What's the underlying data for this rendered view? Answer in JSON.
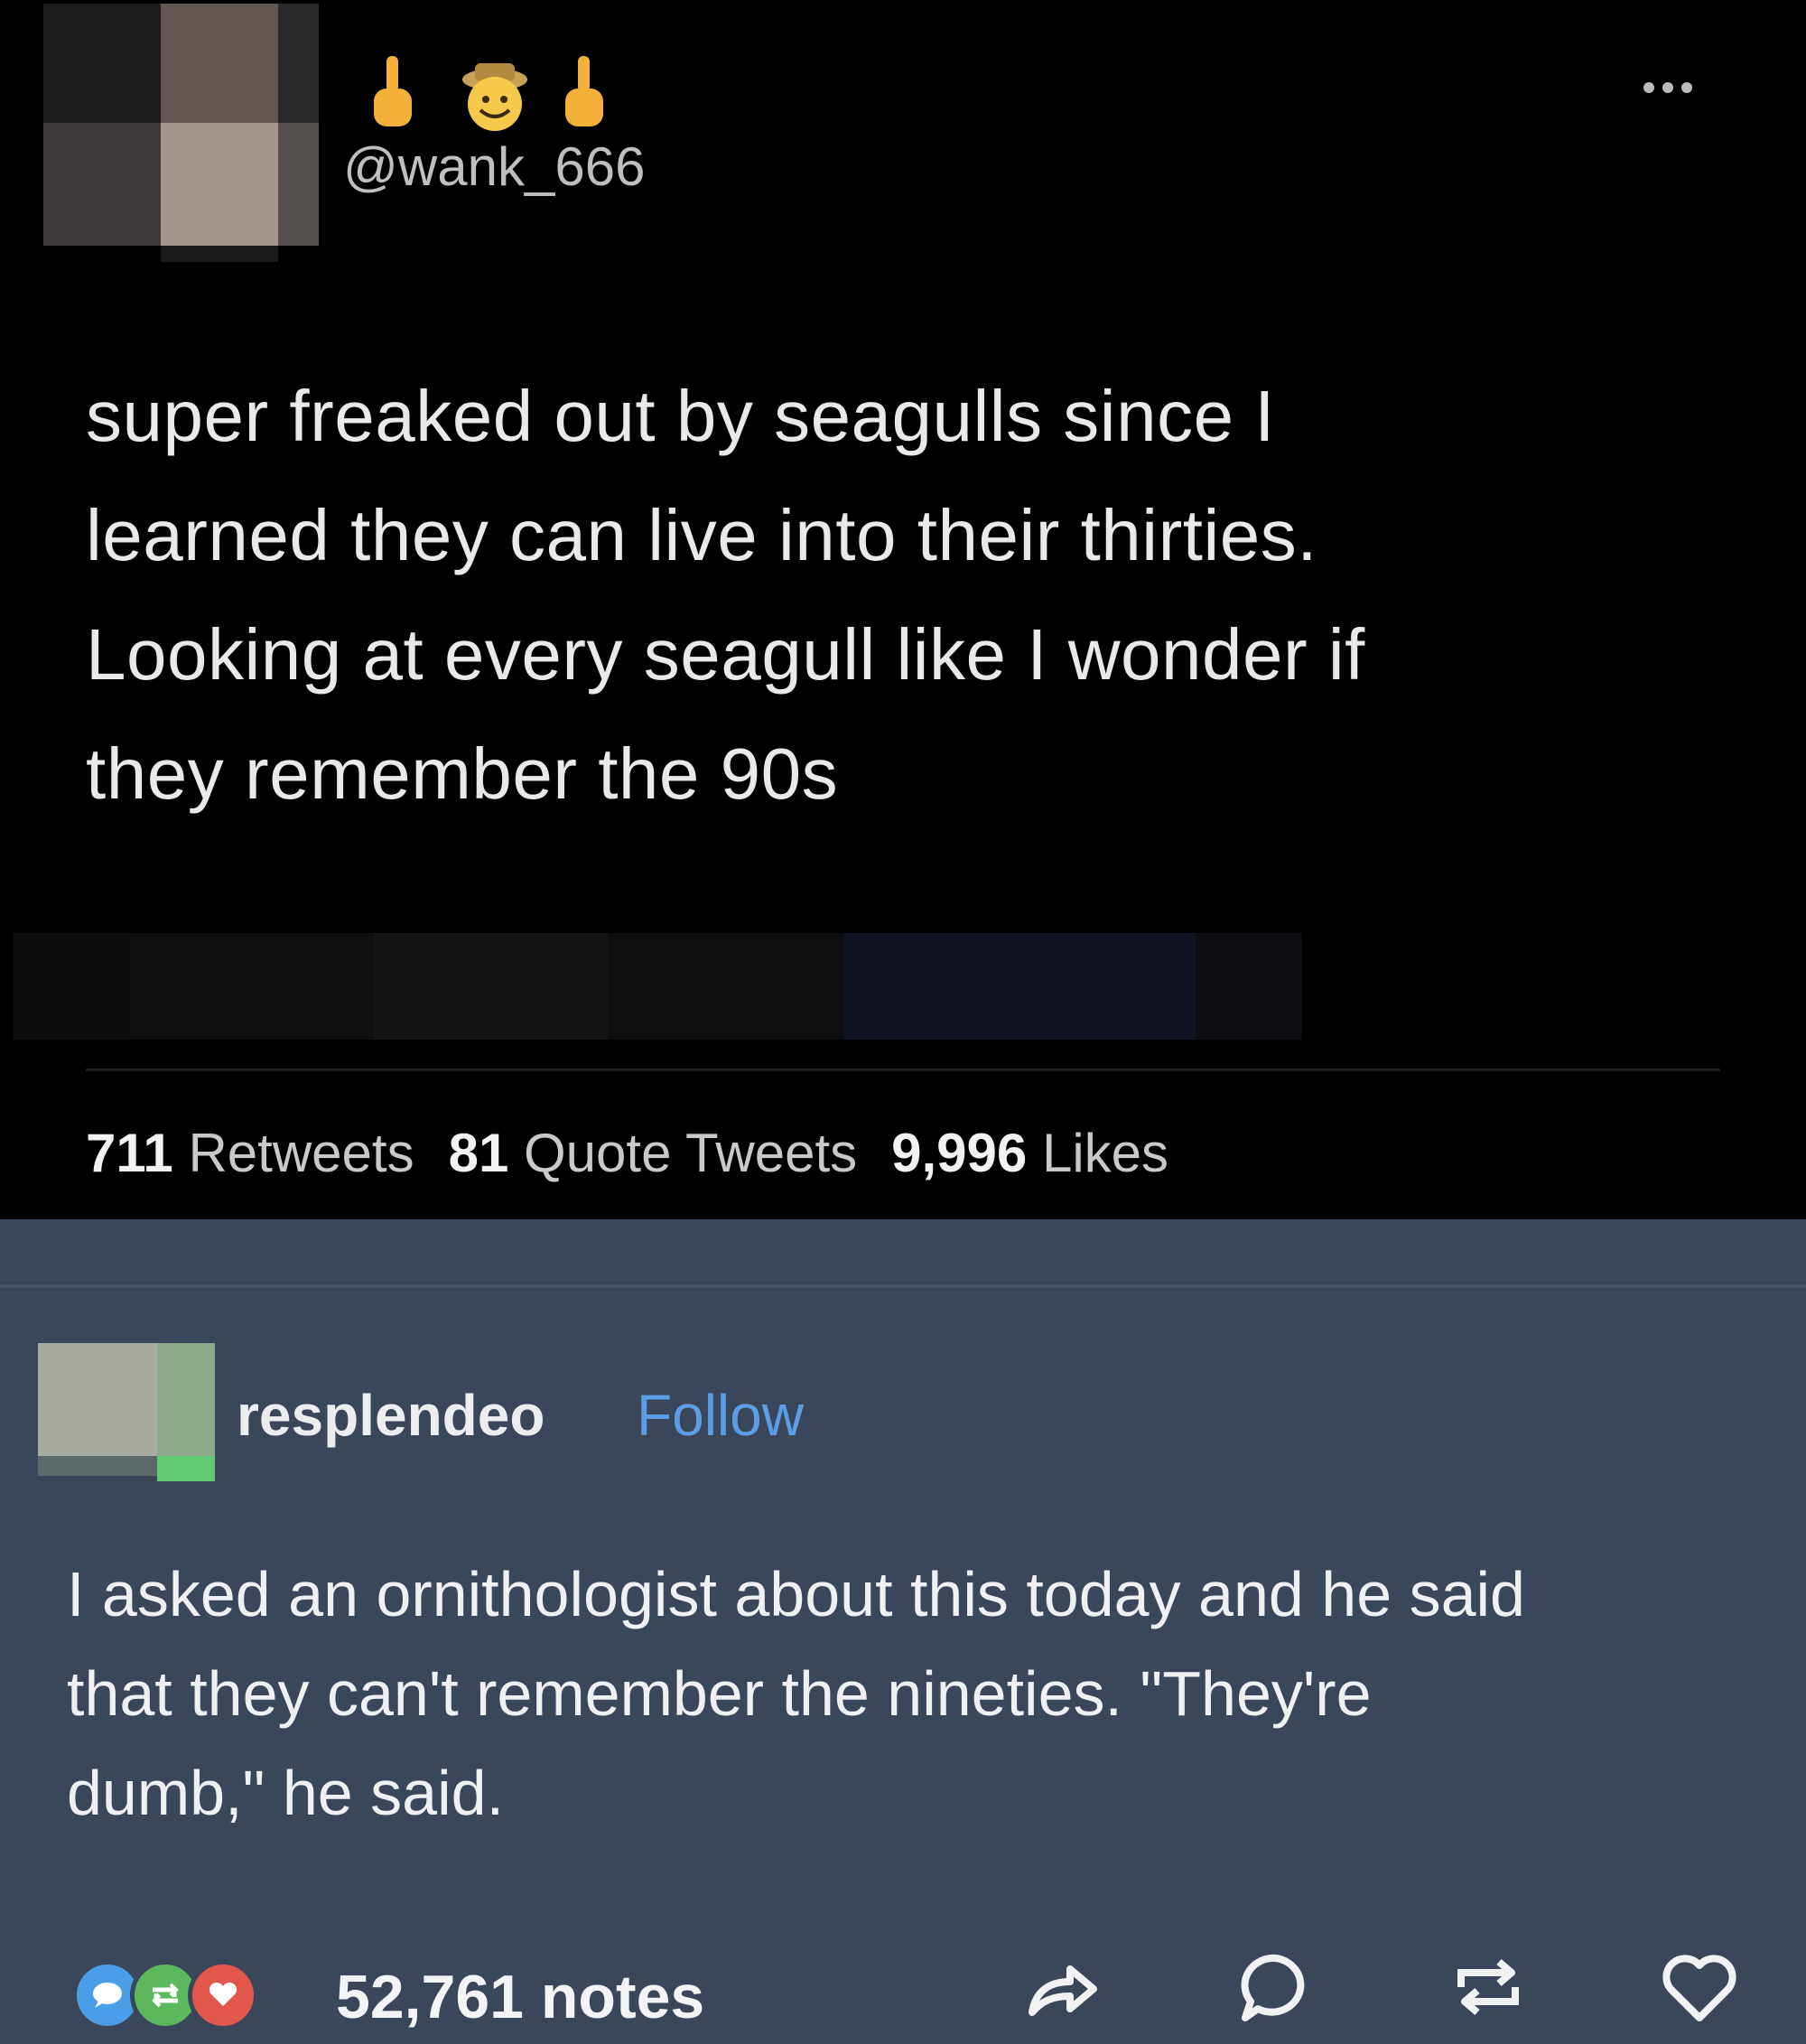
{
  "tweet": {
    "handle": "@wank_666",
    "text_lines": [
      "super freaked out by seagulls since I",
      "learned they can live into their thirties.",
      "Looking at every seagull like I wonder if",
      "they remember the 90s"
    ],
    "stats": {
      "retweets_count": "711",
      "retweets_label": "Retweets",
      "quote_count": "81",
      "quote_label": "Quote Tweets",
      "likes_count": "9,996",
      "likes_label": "Likes"
    },
    "display_name_emojis": [
      "middle-finger-icon",
      "cowboy-face-icon",
      "middle-finger-icon"
    ]
  },
  "tumblr": {
    "username": "resplendeo",
    "follow_label": "Follow",
    "text_lines": [
      "I asked an ornithologist about this today and he said",
      "that they can't remember the nineties. \"They're",
      "dumb,\" he said."
    ],
    "notes": "52,761 notes",
    "actions": [
      "share-icon",
      "reply-icon",
      "reblog-icon",
      "like-icon"
    ],
    "note_icons": [
      "comment-note-icon",
      "reblog-note-icon",
      "like-note-icon"
    ]
  },
  "colors": {
    "tweet_bg": "#000000",
    "tumblr_bg": "#3a4659",
    "follow_blue": "#5b9ee6",
    "note_blue": "#4a9ee8",
    "note_green": "#5cb85c",
    "note_red": "#e2574c"
  }
}
